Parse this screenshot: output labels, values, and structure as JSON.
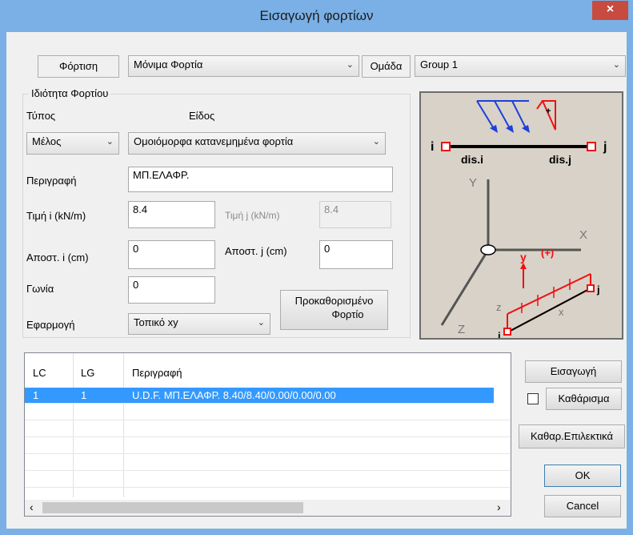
{
  "window": {
    "title": "Εισαγωγή φορτίων",
    "close": "×"
  },
  "top": {
    "load_label": "Φόρτιση",
    "load_value": "Μόνιμα Φορτία",
    "group_label": "Ομάδα",
    "group_value": "Group 1"
  },
  "props": {
    "group_title": "Ιδιότητα Φορτίου",
    "type_label": "Τύπος",
    "kind_label": "Είδος",
    "type_value": "Μέλος",
    "kind_value": "Ομοιόμορφα κατανεμημένα φορτία",
    "desc_label": "Περιγραφή",
    "desc_value": "ΜΠ.ΕΛΑΦΡ.",
    "value_i_label": "Τιμή i (kN/m)",
    "value_i": "8.4",
    "value_j_label": "Τιμή j (kN/m)",
    "value_j": "8.4",
    "dist_i_label": "Αποστ. i (cm)",
    "dist_i": "0",
    "dist_j_label": "Αποστ. j (cm)",
    "dist_j": "0",
    "angle_label": "Γωνία",
    "angle": "0",
    "apply_label": "Εφαρμογή",
    "apply_value": "Τοπικό xy",
    "predefined_line1": "Προκαθορισμένο",
    "predefined_line2": "Φορτίο"
  },
  "diagram": {
    "i": "i",
    "j": "j",
    "dis_i": "dis.i",
    "dis_j": "dis.j",
    "Y": "Y",
    "X": "X",
    "Z": "Z",
    "x": "x",
    "y": "y",
    "z": "z",
    "plus": "(+)"
  },
  "table": {
    "headers": [
      "LC",
      "LG",
      "Περιγραφή"
    ],
    "rows": [
      {
        "lc": "1",
        "lg": "1",
        "desc": "U.D.F. ΜΠ.ΕΛΑΦΡ. 8.40/8.40/0.00/0.00/0.00"
      }
    ]
  },
  "buttons": {
    "insert": "Εισαγωγή",
    "clear": "Καθάρισμα",
    "clear_selected": "Καθαρ.Επιλεκτικά",
    "ok": "OK",
    "cancel": "Cancel"
  },
  "colors": {
    "accent": "#3399ff",
    "titlebar": "#7ab0e6",
    "close": "#c74b3e"
  }
}
